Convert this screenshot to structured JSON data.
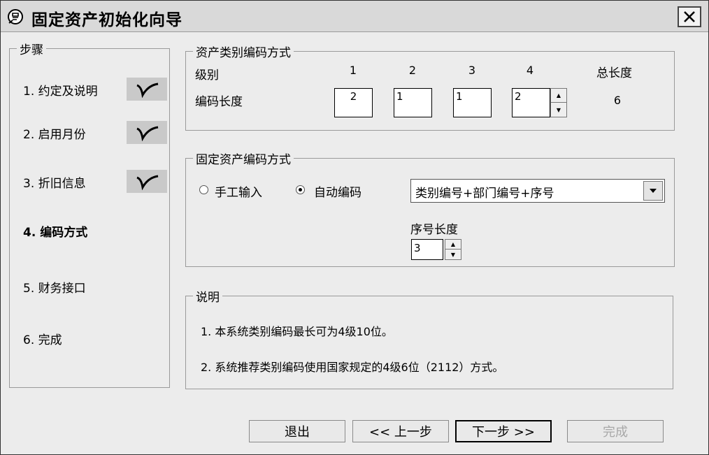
{
  "window": {
    "title": "固定资产初始化向导"
  },
  "steps": {
    "caption": "步骤",
    "items": [
      {
        "label": "1. 约定及说明"
      },
      {
        "label": "2. 启用月份"
      },
      {
        "label": "3. 折旧信息"
      },
      {
        "label": "4. 编码方式"
      },
      {
        "label": "5. 财务接口"
      },
      {
        "label": "6. 完成"
      }
    ]
  },
  "category_coding": {
    "caption": "资产类别编码方式",
    "level_label": "级别",
    "length_label": "编码长度",
    "total_label": "总长度",
    "levels": [
      "1",
      "2",
      "3",
      "4"
    ],
    "lengths": [
      "2",
      "1",
      "1",
      "2"
    ],
    "total": "6"
  },
  "asset_coding": {
    "caption": "固定资产编码方式",
    "manual_label": "手工输入",
    "auto_label": "自动编码",
    "selected_mode": "自动编码",
    "scheme_value": "类别编号+部门编号+序号",
    "seq_label": "序号长度",
    "seq_value": "3"
  },
  "notes": {
    "caption": "说明",
    "lines": [
      "1. 本系统类别编码最长可为4级10位。",
      "2. 系统推荐类别编码使用国家规定的4级6位（2112）方式。"
    ]
  },
  "buttons": {
    "exit": "退出",
    "prev": "<< 上一步",
    "next": "下一步 >>",
    "finish": "完成"
  }
}
